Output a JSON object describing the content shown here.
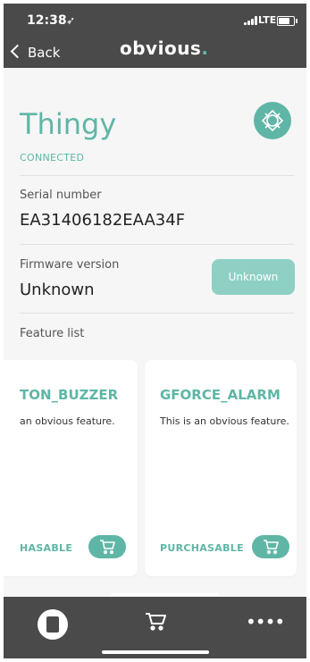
{
  "status_bar": {
    "time": "12:38",
    "network": "LTE"
  },
  "nav": {
    "back_label": "Back",
    "logo_text": "obvious",
    "logo_dot": "."
  },
  "device": {
    "name": "Thingy",
    "state": "CONNECTED",
    "serial_label": "Serial number",
    "serial_value": "EA31406182EAA34F",
    "firmware_label": "Firmware version",
    "firmware_value": "Unknown",
    "firmware_button": "Unknown"
  },
  "features": {
    "label": "Feature list",
    "items": [
      {
        "name": "TON_BUZZER",
        "description": "an obvious feature.",
        "status": "HASABLE"
      },
      {
        "name": "GFORCE_ALARM",
        "description": "This is an obvious feature.",
        "status": "PURCHASABLE"
      }
    ]
  },
  "theme": {
    "accent": "#5fb6a6",
    "accent_light": "#8fd0c4",
    "bar": "#4a4a4a"
  },
  "icons": {
    "device_badge": "device-chip-icon",
    "tabs": [
      "device-tab-icon",
      "shop-cart-icon",
      "more-dots-icon"
    ]
  },
  "more_label": "••••"
}
